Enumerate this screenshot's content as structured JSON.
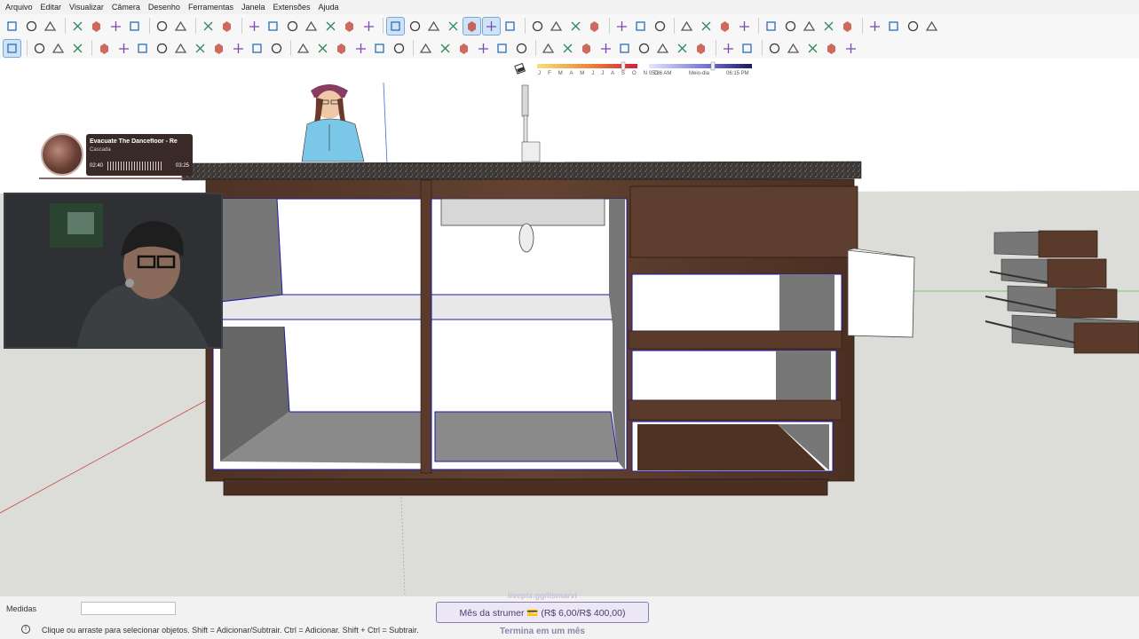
{
  "menu": [
    "Arquivo",
    "Editar",
    "Visualizar",
    "Câmera",
    "Desenho",
    "Ferramentas",
    "Janela",
    "Extensões",
    "Ajuda"
  ],
  "toolbar1_icons": [
    "new-file-icon",
    "open-icon",
    "save-icon",
    "cut-icon",
    "copy-icon",
    "paste-icon",
    "erase-icon",
    "undo-icon",
    "redo-icon",
    "print-icon",
    "model-info-icon",
    "iso-view-icon",
    "top-view-icon",
    "front-view-icon",
    "right-view-icon",
    "back-view-icon",
    "left-view-icon",
    "bottom-view-icon",
    "xray-icon",
    "back-edges-icon",
    "wireframe-icon",
    "hidden-line-icon",
    "shaded-icon",
    "textured-icon",
    "monochrome-icon",
    "outer-shell-icon",
    "intersect-icon",
    "union-icon",
    "subtract-icon",
    "trim-icon",
    "split-icon",
    "components-icon",
    "sandbox-icon",
    "warehouse-icon",
    "extension-warehouse-icon",
    "layout-icon",
    "add-location-icon",
    "terrain-icon",
    "photo-texture-icon",
    "cloud-icon",
    "settings-icon",
    "window-icon",
    "info-icon",
    "cart-icon",
    "account-icon"
  ],
  "toolbar2_icons": [
    "select-icon",
    "orbit-icon",
    "paint-bucket-icon",
    "eraser-icon",
    "line-icon",
    "arc-icon",
    "rectangle-icon",
    "rotated-rectangle-icon",
    "circle-icon",
    "polygon-icon",
    "freehand-icon",
    "three-point-arc-icon",
    "pie-icon",
    "two-point-arc-icon",
    "move-icon",
    "push-pull-icon",
    "rotate-icon",
    "follow-me-icon",
    "scale-icon",
    "offset-icon",
    "tape-measure-icon",
    "dimension-icon",
    "protractor-icon",
    "text-icon",
    "axes-icon",
    "3d-text-icon",
    "section-plane-icon",
    "pan-icon",
    "zoom-icon",
    "zoom-window-icon",
    "zoom-extents-icon",
    "previous-view-icon",
    "position-camera-icon",
    "look-around-icon",
    "walk-icon",
    "iso-box-icon",
    "components-box-icon",
    "solid-tools-icon",
    "mirror-icon",
    "curve-icon",
    "layers-icon",
    "outliner-icon"
  ],
  "shadow": {
    "months": "J F M A M J J A S O N D",
    "time_start": "05:36 AM",
    "time_mid": "Meio-dia",
    "time_end": "06:15 PM"
  },
  "music": {
    "title": "Evacuate The Dancefloor - Re",
    "artist": "Cascada",
    "elapsed": "02:40",
    "duration": "03:25"
  },
  "status": {
    "medidas_label": "Medidas",
    "medidas_value": "",
    "hint": "Clique ou arraste para selecionar objetos. Shift = Adicionar/Subtrair. Ctrl = Adicionar. Shift + Ctrl = Subtrair.",
    "goal_top": "livepix.gg/lismarvl",
    "goal_text": "Mês da strumer 💳 (R$ 6,00/R$ 400,00)",
    "goal_sub": "Termina em um mês"
  },
  "colors": {
    "wood": "#5a3a2a",
    "granite": "#3e3a38",
    "accent_select": "#cfe3f7"
  }
}
